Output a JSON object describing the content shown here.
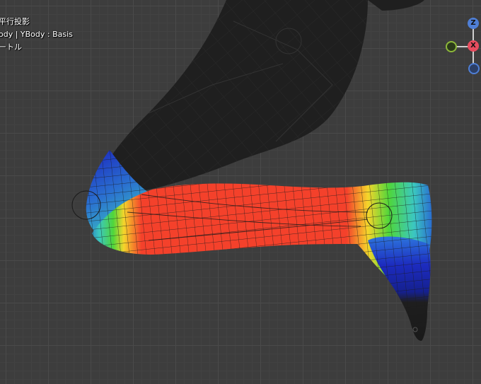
{
  "overlay": {
    "projection": "平行投影",
    "object_info": "ody | YBody : Basis",
    "units": "ートル"
  },
  "gizmo": {
    "z_label": "Z",
    "x_label": "X",
    "z_color": "#4f7fd6",
    "x_color": "#e84d5f",
    "y_color": "#8db83a",
    "neg_z_color": "#3a5ea3"
  },
  "colors": {
    "body_mesh": "#1f1f1f",
    "weight_high": "#f4412b",
    "weight_mid": "#f5d52b",
    "weight_low_green": "#4fd63b",
    "weight_low_cyan": "#3bc7c0",
    "weight_zero": "#1c2bbf"
  }
}
